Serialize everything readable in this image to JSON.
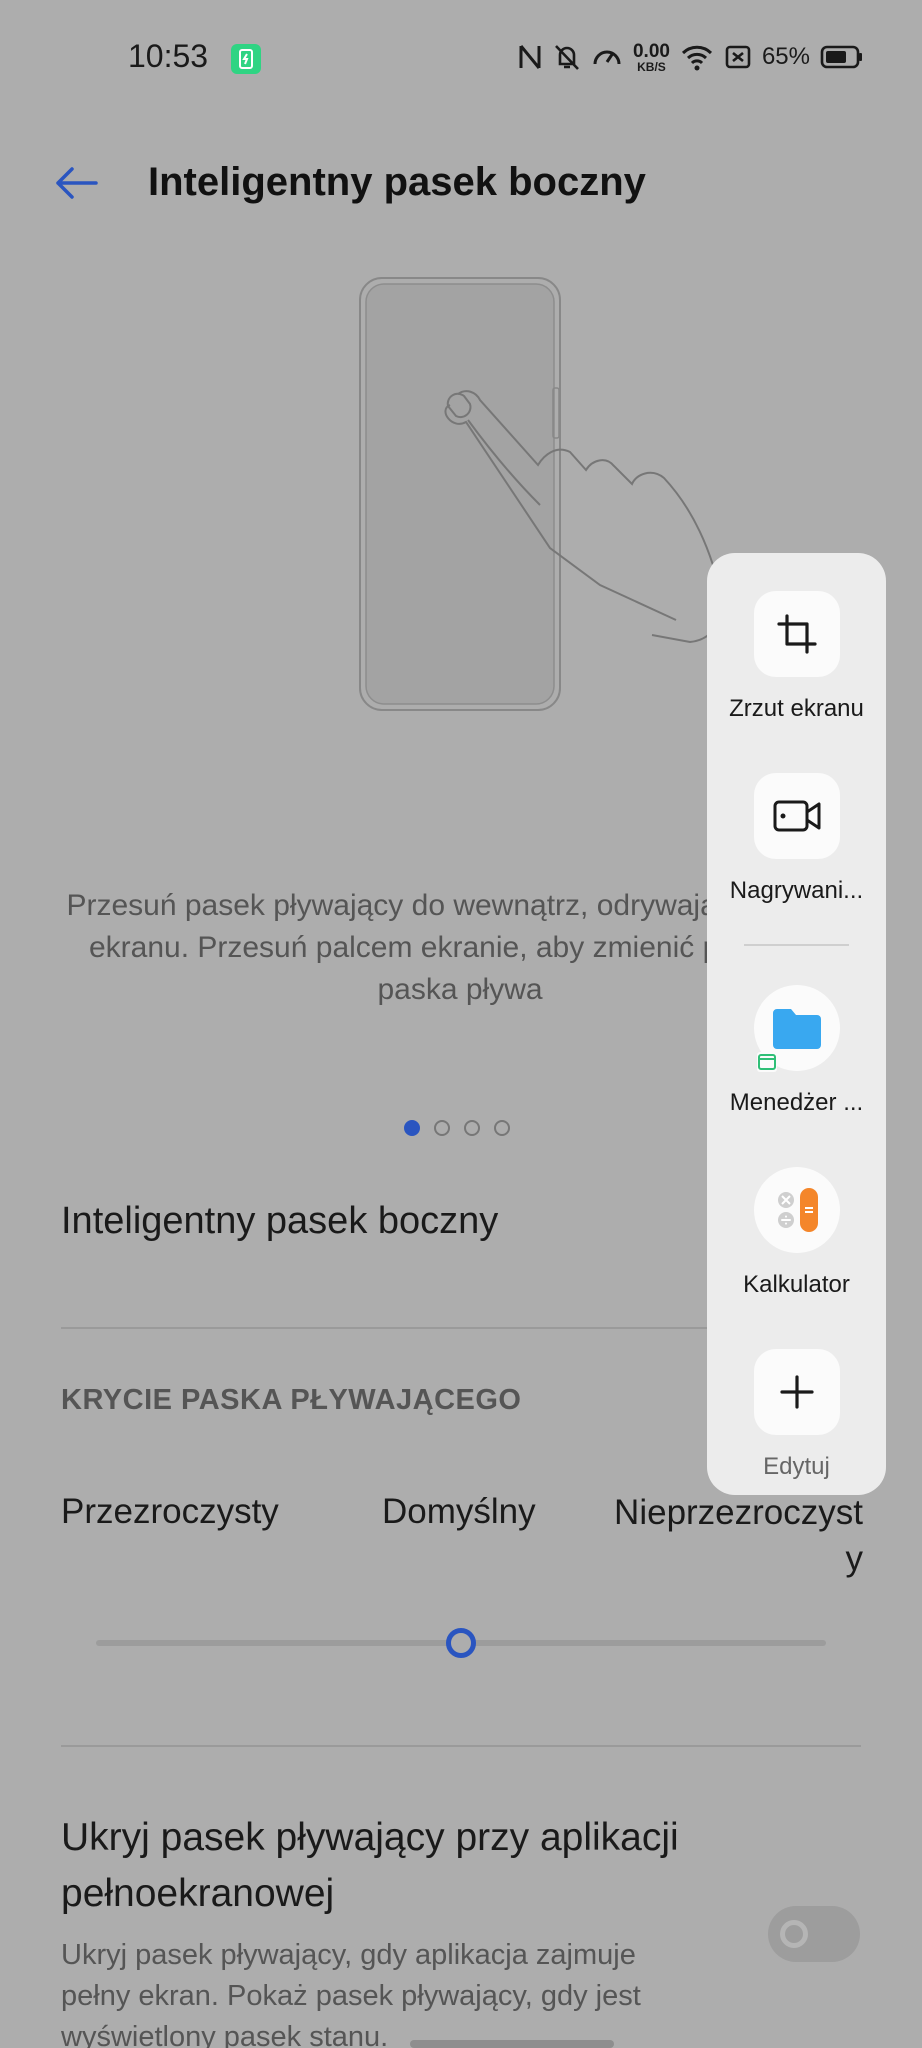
{
  "status_bar": {
    "time": "10:53",
    "speed_value": "0.00",
    "speed_unit": "KB/S",
    "battery_percent": "65%"
  },
  "header": {
    "title": "Inteligentny pasek boczny"
  },
  "description": "Przesuń pasek pływający do wewnątrz, odrywając palca od ekranu. Przesuń palcem ekranie, aby zmienić położenie paska pływa",
  "pager": {
    "pages": 4,
    "active_index": 0
  },
  "settings": {
    "sidebar_toggle_label": "Inteligentny pasek boczny",
    "opacity_section": "KRYCIE PASKA PŁYWAJĄCEGO",
    "opacity_options": [
      "Przezroczysty",
      "Domyślny",
      "Nieprzezroczyst y"
    ],
    "opacity_value": 0.5,
    "hide_title": "Ukryj pasek pływający przy aplikacji pełnoekranowej",
    "hide_description": "Ukryj pasek pływający, gdy aplikacja zajmuje pełny ekran. Pokaż pasek pływający, gdy jest wyświetlony pasek stanu.",
    "hide_enabled": false
  },
  "floating_bar": {
    "items": [
      {
        "label": "Zrzut ekranu",
        "icon": "crop-icon"
      },
      {
        "label": "Nagrywani...",
        "icon": "screen-record-icon"
      },
      {
        "label": "Menedżer ...",
        "icon": "folder-icon"
      },
      {
        "label": "Kalkulator",
        "icon": "calculator-icon"
      },
      {
        "label": "Edytuj",
        "icon": "plus-icon"
      }
    ]
  },
  "colors": {
    "accent": "#2a55c0",
    "background_dim": "#adadad",
    "panel": "#ececec",
    "folder": "#39a8f0",
    "calculator": "#f4862a",
    "charging": "#2fd483"
  }
}
